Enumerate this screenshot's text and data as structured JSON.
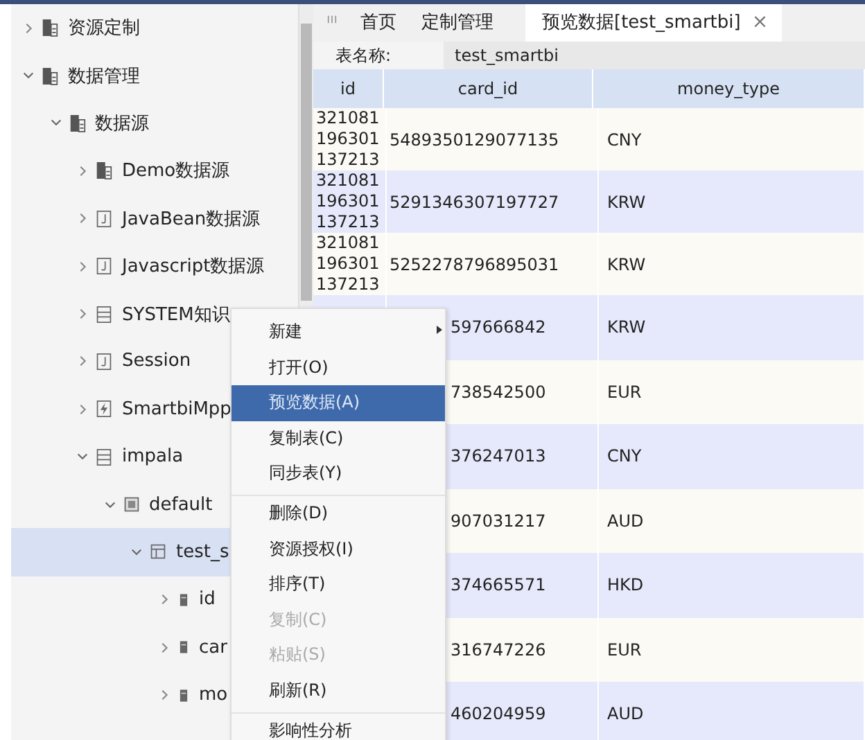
{
  "tree": [
    {
      "label": "资源定制",
      "kind": "folder",
      "expanded": false,
      "selected": false
    },
    {
      "label": "数据管理",
      "kind": "folder",
      "expanded": true,
      "selected": false,
      "children": [
        {
          "label": "数据源",
          "kind": "folder",
          "expanded": true,
          "selected": false,
          "children": [
            {
              "label": "Demo数据源",
              "kind": "folder",
              "expanded": false,
              "selected": false
            },
            {
              "label": "JavaBean数据源",
              "kind": "jfile",
              "expanded": false,
              "selected": false
            },
            {
              "label": "Javascript数据源",
              "kind": "jfile",
              "expanded": false,
              "selected": false
            },
            {
              "label": "SYSTEM知识",
              "kind": "list",
              "expanded": false,
              "selected": false
            },
            {
              "label": "Session",
              "kind": "jfile",
              "expanded": false,
              "selected": false
            },
            {
              "label": "SmartbiMpp",
              "kind": "bolt",
              "expanded": false,
              "selected": false
            },
            {
              "label": "impala",
              "kind": "list",
              "expanded": true,
              "selected": false,
              "children": [
                {
                  "label": "default",
                  "kind": "schema",
                  "expanded": true,
                  "selected": false,
                  "children": [
                    {
                      "label": "test_s",
                      "kind": "table",
                      "expanded": true,
                      "selected": true,
                      "children": [
                        {
                          "label": "id",
                          "kind": "column",
                          "expanded": false,
                          "selected": false
                        },
                        {
                          "label": "car",
                          "kind": "column",
                          "expanded": false,
                          "selected": false
                        },
                        {
                          "label": "mo",
                          "kind": "column",
                          "expanded": false,
                          "selected": false
                        }
                      ]
                    }
                  ]
                }
              ]
            }
          ]
        }
      ]
    }
  ],
  "tabs": [
    {
      "label": "首页",
      "selected": false,
      "closable": false
    },
    {
      "label": "定制管理",
      "selected": false,
      "closable": false
    },
    {
      "label": "预览数据[test_smartbi]",
      "selected": true,
      "closable": true
    }
  ],
  "tab_close": "×",
  "table_name": {
    "label": "表名称:",
    "value": "test_smartbi"
  },
  "table": {
    "columns": [
      "id",
      "card_id",
      "money_type"
    ],
    "rows": [
      {
        "id_lines": [
          "321081",
          "196301",
          "137213"
        ],
        "card_id": "5489350129077135",
        "money_type": "CNY",
        "covered": false
      },
      {
        "id_lines": [
          "321081",
          "196301",
          "137213"
        ],
        "card_id": "5291346307197727",
        "money_type": "KRW",
        "covered": false
      },
      {
        "id_lines": [
          "321081",
          "196301",
          "137213"
        ],
        "card_id": "5252278796895031",
        "money_type": "KRW",
        "covered": false
      },
      {
        "card_id": "597666842",
        "money_type": "KRW",
        "covered": true
      },
      {
        "card_id": "738542500",
        "money_type": "EUR",
        "covered": true
      },
      {
        "card_id": "376247013",
        "money_type": "CNY",
        "covered": true
      },
      {
        "card_id": "907031217",
        "money_type": "AUD",
        "covered": true
      },
      {
        "card_id": "374665571",
        "money_type": "HKD",
        "covered": true
      },
      {
        "card_id": "316747226",
        "money_type": "EUR",
        "covered": true
      },
      {
        "card_id": "460204959",
        "money_type": "AUD",
        "covered": true
      }
    ]
  },
  "context_menu": [
    {
      "label": "新建",
      "selected": false,
      "disabled": false,
      "submenu": true,
      "separator_before": false
    },
    {
      "label": "打开(O)",
      "selected": false,
      "disabled": false,
      "submenu": false,
      "separator_before": false
    },
    {
      "label": "预览数据(A)",
      "selected": true,
      "disabled": false,
      "submenu": false,
      "separator_before": false
    },
    {
      "label": "复制表(C)",
      "selected": false,
      "disabled": false,
      "submenu": false,
      "separator_before": false
    },
    {
      "label": "同步表(Y)",
      "selected": false,
      "disabled": false,
      "submenu": false,
      "separator_before": false
    },
    {
      "label": "删除(D)",
      "selected": false,
      "disabled": false,
      "submenu": false,
      "separator_before": true
    },
    {
      "label": "资源授权(I)",
      "selected": false,
      "disabled": false,
      "submenu": false,
      "separator_before": false
    },
    {
      "label": "排序(T)",
      "selected": false,
      "disabled": false,
      "submenu": false,
      "separator_before": false
    },
    {
      "label": "复制(C)",
      "selected": false,
      "disabled": true,
      "submenu": false,
      "separator_before": false
    },
    {
      "label": "粘贴(S)",
      "selected": false,
      "disabled": true,
      "submenu": false,
      "separator_before": false
    },
    {
      "label": "刷新(R)",
      "selected": false,
      "disabled": false,
      "submenu": false,
      "separator_before": false
    },
    {
      "label": "影响性分析",
      "selected": false,
      "disabled": false,
      "submenu": false,
      "separator_before": true
    }
  ]
}
